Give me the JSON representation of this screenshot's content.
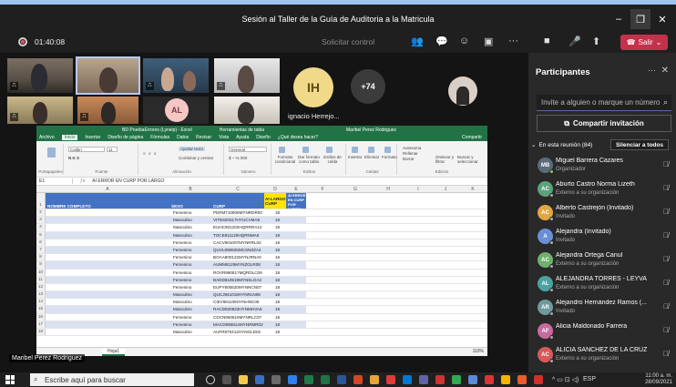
{
  "window": {
    "title": "Sesión al Taller de la Guía de Auditoria a la Matricula"
  },
  "toolbar": {
    "timer": "01:40:08",
    "request_control": "Solicitar control",
    "leave_label": "Salir"
  },
  "stage": {
    "overflow_count": "+74",
    "avatars": [
      {
        "initials": "AL",
        "bg": "#f5c6c6",
        "fg": "#7a3b3b"
      },
      {
        "initials": "IH",
        "bg": "#f1d98a",
        "fg": "#5c4a10",
        "name": "ignacio Herrejo..."
      }
    ],
    "presenter_name": "Maribel Perez Rodriguez"
  },
  "excel": {
    "file_title": "BD PruebaErrores (Lyneip) - Excel",
    "status_text": "Herramientas de tabla",
    "user": "Maribel Perez Rodriguez",
    "ribbon_tabs": [
      "Archivo",
      "Inicio",
      "Insertar",
      "Diseño de página",
      "Fórmulas",
      "Datos",
      "Revisar",
      "Vista",
      "Ayuda",
      "Diseño",
      "¿Qué desea hacer?"
    ],
    "share": "Compartir",
    "font_name": "Calibri",
    "font_size": "11",
    "wrap": "Ajustar texto",
    "merge": "Combinar y centrar",
    "number_format": "General",
    "groups": [
      "Portapapeles",
      "Fuente",
      "Alineación",
      "Número",
      "Estilos",
      "Celdas",
      "Edición"
    ],
    "style_buttons": [
      "Formato condicional",
      "Dar formato como tabla",
      "Estilos de celda"
    ],
    "cell_buttons": [
      "Insertar",
      "Eliminar",
      "Formato"
    ],
    "edit_items": [
      "Autosuma",
      "Rellenar",
      "Borrar",
      "Ordenar y filtrar",
      "Buscar y seleccionar"
    ],
    "name_box": "E1",
    "formula": "AI ERROR EN CURP POR LARGO",
    "columns": [
      "A",
      "B",
      "C",
      "D",
      "E",
      "F",
      "G",
      "H",
      "I",
      "J",
      "K"
    ],
    "headers": {
      "a": "NOMBRE COMPLETO",
      "b": "SEXO",
      "c": "CURP",
      "d": "AI LARGO CURP",
      "e": "AI ERROR EN CURP POR LARGO"
    },
    "rows": [
      {
        "n": "2",
        "sexo": "Femenino",
        "curp": "PERM710909MYNRDR00",
        "largo": "18"
      },
      {
        "n": "3",
        "sexo": "Masculino",
        "curp": "VITE620417HYUCVMA8",
        "largo": "18"
      },
      {
        "n": "4",
        "sexo": "Masculino",
        "curp": "EUHC901202HQRRRA12",
        "largo": "18"
      },
      {
        "n": "5",
        "sexo": "Masculino",
        "curp": "TOCE811120HQRNMA6",
        "largo": "18"
      },
      {
        "n": "6",
        "sexo": "Femenino",
        "curp": "CACV901007MYNRRL03",
        "largo": "18"
      },
      {
        "n": "7",
        "sexo": "Femenino",
        "curp": "QUVL890825MCSNZZA4",
        "largo": "18"
      },
      {
        "n": "8",
        "sexo": "Femenino",
        "curp": "BOAA800122MYNJRNA0",
        "largo": "18"
      },
      {
        "n": "9",
        "sexo": "Femenino",
        "curp": "AUMM8125MYNZGLR08",
        "largo": "18"
      },
      {
        "n": "10",
        "sexo": "Femenino",
        "curp": "ROVR990517MQRDLC09",
        "largo": "18"
      },
      {
        "n": "11",
        "sexo": "Femenino",
        "curp": "BADD810519MYNSLGA2",
        "largo": "18"
      },
      {
        "n": "12",
        "sexo": "Femenino",
        "curp": "EUPY900620MYNNCN07",
        "largo": "18"
      },
      {
        "n": "13",
        "sexo": "Masculino",
        "curp": "QUCJ941018HYNRLN06",
        "largo": "18"
      },
      {
        "n": "14",
        "sexo": "Masculino",
        "curp": "CIEV981108HYNHNC05",
        "largo": "18"
      },
      {
        "n": "15",
        "sexo": "Masculino",
        "curp": "RACD920923HYNMHVA6",
        "largo": "18"
      },
      {
        "n": "16",
        "sexo": "Femenino",
        "curp": "CDCN950519MYNRLC07",
        "largo": "18"
      },
      {
        "n": "17",
        "sexo": "Femenino",
        "curp": "MACD990814MYNRMR02",
        "largo": "18"
      },
      {
        "n": "18",
        "sexo": "Masculino",
        "curp": "AUFR970412HYNGLD02",
        "largo": "18"
      }
    ],
    "sheet_tab": "Hoja1",
    "zoom": "110%"
  },
  "panel": {
    "title": "Participantes",
    "invite_placeholder": "Invite a alguien o marque un número",
    "share_invite": "Compartir invitación",
    "in_meeting": "En esta reunión (84)",
    "mute_all": "Silenciar a todos",
    "participants": [
      {
        "name": "Miguel Barrera Cazares",
        "role": "Organizador",
        "initials": "MB",
        "bg": "#5a6b7a",
        "status": "#92c353"
      },
      {
        "name": "Aburto Castro Norma Lizeth",
        "role": "Externo a su organización",
        "initials": "AC",
        "bg": "#5aa37a",
        "status": "#aaaaaa"
      },
      {
        "name": "Alberto Castrejón (Invitado)",
        "role": "Invitado",
        "initials": "AC",
        "bg": "#e0a640",
        "status": "#aaaaaa"
      },
      {
        "name": "Alejandra (Invitado)",
        "role": "Invitado",
        "initials": "A",
        "bg": "#6a8fd4",
        "status": "#aaaaaa"
      },
      {
        "name": "Alejandra Ortega Canul",
        "role": "Externo a su organización",
        "initials": "AC",
        "bg": "#6fb06f",
        "status": "#aaaaaa"
      },
      {
        "name": "ALEJANDRA TORRES - LEYVA",
        "role": "Externo a su organización",
        "initials": "AL",
        "bg": "#4aa3a0",
        "status": "#aaaaaa"
      },
      {
        "name": "Alejandro Hernández Ramos (...",
        "role": "Invitado",
        "initials": "AR",
        "bg": "#6e9a9a",
        "status": "#aaaaaa"
      },
      {
        "name": "Alicia Maldonado Farrera",
        "role": "",
        "initials": "AF",
        "bg": "#c96a9e",
        "status": "#aaaaaa"
      },
      {
        "name": "ALICIA SANCHEZ DE LA CRUZ",
        "role": "Externo a su organización",
        "initials": "AC",
        "bg": "#d65a5a",
        "status": "#aaaaaa"
      }
    ]
  },
  "taskbar": {
    "search_placeholder": "Escribe aquí para buscar",
    "lang": "ESP",
    "time": "11:00 a. m.",
    "date": "28/09/2021"
  }
}
